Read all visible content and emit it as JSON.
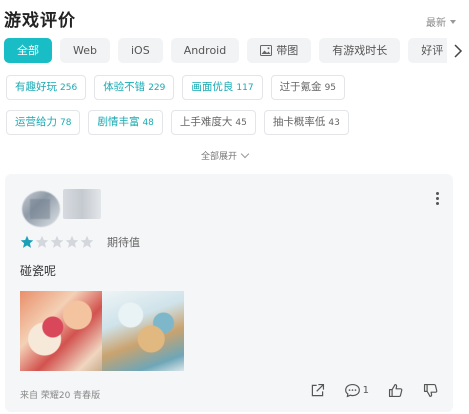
{
  "header": {
    "title": "游戏评价",
    "sort_label": "最新"
  },
  "tabs": [
    {
      "label": "全部",
      "active": true
    },
    {
      "label": "Web"
    },
    {
      "label": "iOS"
    },
    {
      "label": "Android"
    },
    {
      "label": "带图",
      "icon": "image-icon"
    },
    {
      "label": "有游戏时长"
    },
    {
      "label": "好评"
    }
  ],
  "tags": [
    {
      "label": "有趣好玩",
      "count": "256",
      "style": "teal"
    },
    {
      "label": "体验不错",
      "count": "229",
      "style": "teal"
    },
    {
      "label": "画面优良",
      "count": "117",
      "style": "teal"
    },
    {
      "label": "过于氪金",
      "count": "95",
      "style": "gray"
    },
    {
      "label": "运营给力",
      "count": "78",
      "style": "teal"
    },
    {
      "label": "剧情丰富",
      "count": "48",
      "style": "teal"
    },
    {
      "label": "上手难度大",
      "count": "45",
      "style": "gray"
    },
    {
      "label": "抽卡概率低",
      "count": "43",
      "style": "gray"
    }
  ],
  "expand_label": "全部展开",
  "review": {
    "rating": 1,
    "rating_max": 5,
    "rating_label": "期待值",
    "text": "碰瓷呢",
    "source": "来自 荣耀20 青春版",
    "comment_count": "1"
  },
  "colors": {
    "accent": "#18bdc6",
    "star_on": "#1aa0b8",
    "star_off": "#d4d7db"
  }
}
